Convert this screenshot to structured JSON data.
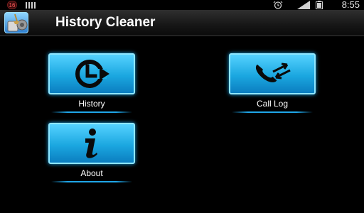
{
  "statusbar": {
    "notification_count": "16",
    "time": "8:55"
  },
  "app": {
    "title": "History Cleaner"
  },
  "menu": [
    {
      "label": "History",
      "icon": "history-icon"
    },
    {
      "label": "Call Log",
      "icon": "call-log-icon"
    },
    {
      "label": "About",
      "icon": "info-icon"
    }
  ],
  "colors": {
    "background": "#000000",
    "tile": "#1ba7e0",
    "tile_border": "#8fe6ff",
    "icon": "#0a0a0a",
    "text": "#ffffff"
  }
}
